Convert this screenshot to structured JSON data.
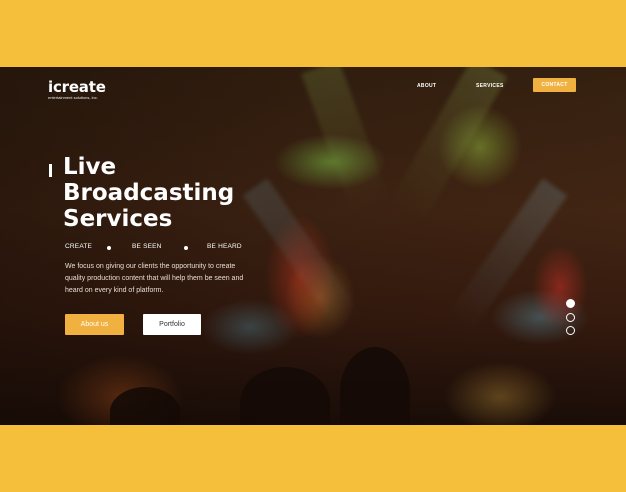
{
  "brand": {
    "name": "icreate",
    "tagline": "entertainment solutions, inc."
  },
  "nav": {
    "about": "ABOUT",
    "services": "SERVICES",
    "contact": "CONTACT"
  },
  "hero": {
    "title_lines": [
      "Live",
      "Broadcasting",
      "Services"
    ],
    "tags": [
      "CREATE",
      "BE SEEN",
      "BE HEARD"
    ],
    "description": "We focus on giving our clients the opportunity to create quality production content that will help them be seen and heard on every kind of platform.",
    "about_button": "About us",
    "portfolio_button": "Portfolio"
  },
  "slider": {
    "count": 3,
    "active_index": 0
  },
  "colors": {
    "accent": "#f0b140",
    "page_background": "#f5bf3c",
    "text": "#ffffff"
  }
}
